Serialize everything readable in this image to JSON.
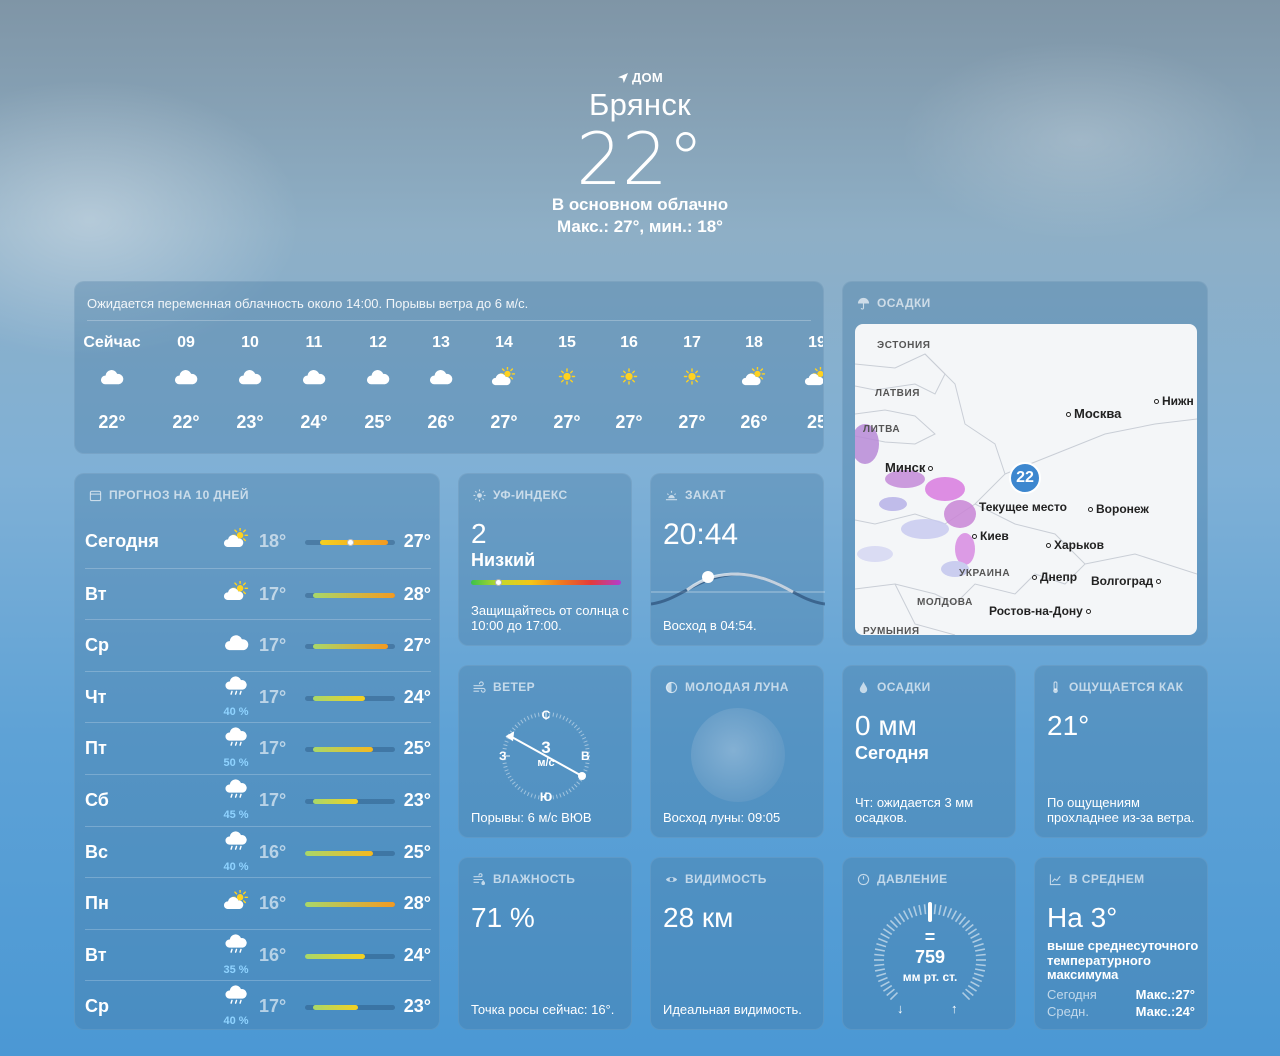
{
  "header": {
    "location_label": "ДОМ",
    "city": "Брянск",
    "temperature": "22°",
    "condition": "В основном облачно",
    "range": "Макс.: 27°, мин.: 18°"
  },
  "hourly": {
    "summary": "Ожидается переменная облачность около 14:00. Порывы ветра до 6 м/с.",
    "hours": [
      {
        "time": "Сейчас",
        "icon": "cloud-icon",
        "temp": "22°"
      },
      {
        "time": "09",
        "icon": "cloud-icon",
        "temp": "22°"
      },
      {
        "time": "10",
        "icon": "cloud-icon",
        "temp": "23°"
      },
      {
        "time": "11",
        "icon": "cloud-icon",
        "temp": "24°"
      },
      {
        "time": "12",
        "icon": "cloud-icon",
        "temp": "25°"
      },
      {
        "time": "13",
        "icon": "cloud-icon",
        "temp": "26°"
      },
      {
        "time": "14",
        "icon": "partly-sunny-icon",
        "temp": "27°"
      },
      {
        "time": "15",
        "icon": "sun-icon",
        "temp": "27°"
      },
      {
        "time": "16",
        "icon": "sun-icon",
        "temp": "27°"
      },
      {
        "time": "17",
        "icon": "sun-icon",
        "temp": "27°"
      },
      {
        "time": "18",
        "icon": "partly-sunny-icon",
        "temp": "26°"
      },
      {
        "time": "19",
        "icon": "partly-sunny-icon",
        "temp": "25"
      }
    ]
  },
  "tenday": {
    "title": "ПРОГНОЗ НА 10 ДНЕЙ",
    "range_min": 16,
    "range_max": 28,
    "current_temp": 22,
    "days": [
      {
        "name": "Сегодня",
        "icon": "partly-sunny-icon",
        "pct": "",
        "low": "18°",
        "high": "27°",
        "lo": 18,
        "hi": 27
      },
      {
        "name": "Вт",
        "icon": "partly-sunny-icon",
        "pct": "",
        "low": "17°",
        "high": "28°",
        "lo": 17,
        "hi": 28
      },
      {
        "name": "Ср",
        "icon": "cloud-icon",
        "pct": "",
        "low": "17°",
        "high": "27°",
        "lo": 17,
        "hi": 27
      },
      {
        "name": "Чт",
        "icon": "rain-icon",
        "pct": "40 %",
        "low": "17°",
        "high": "24°",
        "lo": 17,
        "hi": 24
      },
      {
        "name": "Пт",
        "icon": "rain-icon",
        "pct": "50 %",
        "low": "17°",
        "high": "25°",
        "lo": 17,
        "hi": 25
      },
      {
        "name": "Сб",
        "icon": "rain-icon",
        "pct": "45 %",
        "low": "17°",
        "high": "23°",
        "lo": 17,
        "hi": 23
      },
      {
        "name": "Вс",
        "icon": "rain-icon",
        "pct": "40 %",
        "low": "16°",
        "high": "25°",
        "lo": 16,
        "hi": 25
      },
      {
        "name": "Пн",
        "icon": "partly-sunny-icon",
        "pct": "",
        "low": "16°",
        "high": "28°",
        "lo": 16,
        "hi": 28
      },
      {
        "name": "Вт",
        "icon": "rain-icon",
        "pct": "35 %",
        "low": "16°",
        "high": "24°",
        "lo": 16,
        "hi": 24
      },
      {
        "name": "Ср",
        "icon": "rain-icon",
        "pct": "40 %",
        "low": "17°",
        "high": "23°",
        "lo": 17,
        "hi": 23
      }
    ]
  },
  "uv": {
    "title": "УФ-ИНДЕКС",
    "value": "2",
    "level": "Низкий",
    "note": "Защищайтесь от солнца с 10:00 до 17:00.",
    "index": 2
  },
  "sunset": {
    "title": "ЗАКАТ",
    "time": "20:44",
    "sunrise": "Восход в 04:54."
  },
  "precip_map": {
    "title": "ОСАДКИ",
    "pin_temp": "22",
    "current_place": "Текущее место",
    "cities": [
      "Москва",
      "Нижн",
      "Минск",
      "Воронеж",
      "Киев",
      "Харьков",
      "Днепр",
      "Волгоград",
      "Ростов-на-Дону"
    ],
    "countries": [
      "ЭСТОНИЯ",
      "ЛАТВИЯ",
      "ЛИТВА",
      "УКРАИНА",
      "МОЛДОВА",
      "РУМЫНИЯ"
    ]
  },
  "wind": {
    "title": "ВЕТЕР",
    "speed": "3",
    "unit": "м/с",
    "gusts": "Порывы: 6 м/с ВЮВ",
    "n": "С",
    "e": "В",
    "s": "Ю",
    "w": "З"
  },
  "moon": {
    "title": "МОЛОДАЯ ЛУНА",
    "rise": "Восход луны: 09:05"
  },
  "precip": {
    "title": "ОСАДКИ",
    "value": "0 мм",
    "period": "Сегодня",
    "note": "Чт: ожидается 3 мм осадков."
  },
  "feels": {
    "title": "ОЩУЩАЕТСЯ КАК",
    "value": "21°",
    "note": "По ощущениям прохладнее из-за ветра."
  },
  "humidity": {
    "title": "ВЛАЖНОСТЬ",
    "value": "71 %",
    "note": "Точка росы сейчас: 16°."
  },
  "visibility": {
    "title": "ВИДИМОСТЬ",
    "value": "28 км",
    "note": "Идеальная видимость."
  },
  "pressure": {
    "title": "ДАВЛЕНИЕ",
    "value": "759",
    "unit": "мм рт. ст.",
    "trend": "="
  },
  "average": {
    "title": "В СРЕДНЕМ",
    "value": "На 3°",
    "note": "выше среднесуточного температурного максимума",
    "today_label": "Сегодня",
    "today_value": "Макс.:27°",
    "avg_label": "Средн.",
    "avg_value": "Макс.:24°"
  },
  "colors": {
    "accent_blue": "#3d87cf",
    "precip_pct": "#8fd3ff",
    "sun": "#ffd21f"
  }
}
